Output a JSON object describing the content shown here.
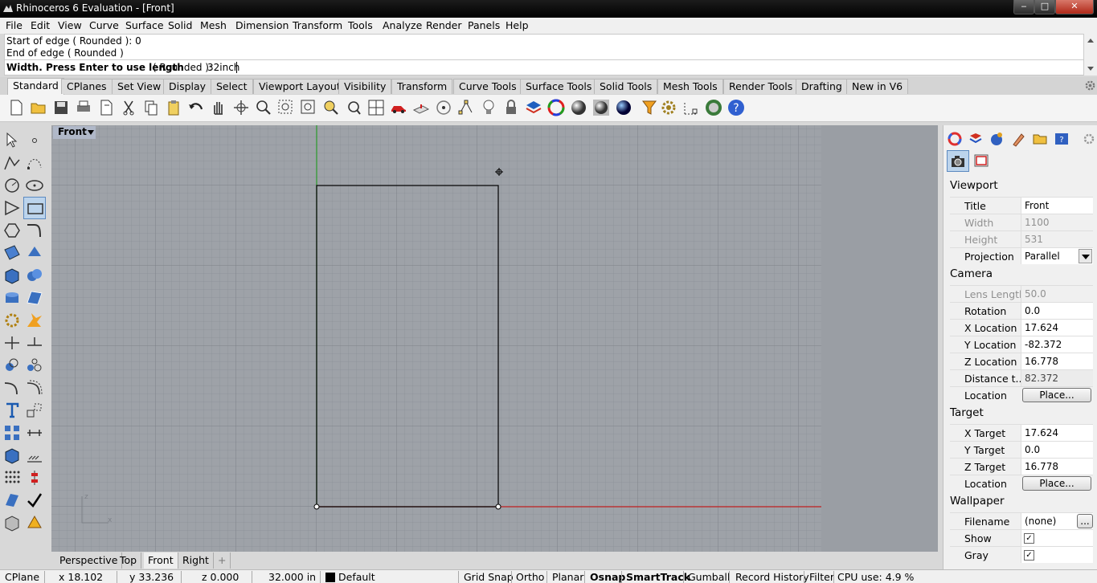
{
  "window": {
    "title": "Rhinoceros 6 Evaluation - [Front]",
    "min": "‒",
    "max": "□",
    "close": "✕"
  },
  "menu": [
    "File",
    "Edit",
    "View",
    "Curve",
    "Surface",
    "Solid",
    "Mesh",
    "Dimension",
    "Transform",
    "Tools",
    "Analyze",
    "Render",
    "Panels",
    "Help"
  ],
  "command": {
    "history": [
      "Start of edge ( Rounded ): 0",
      "End of edge ( Rounded )"
    ],
    "prompt": "Width. Press Enter to use length",
    "option": "( Rounded ):",
    "value": "32inch"
  },
  "toolbar_tabs": [
    "Standard",
    "CPlanes",
    "Set View",
    "Display",
    "Select",
    "Viewport Layout",
    "Visibility",
    "Transform",
    "Curve Tools",
    "Surface Tools",
    "Solid Tools",
    "Mesh Tools",
    "Render Tools",
    "Drafting",
    "New in V6"
  ],
  "viewport": {
    "name": "Front",
    "axis_z": "z",
    "axis_x": "x"
  },
  "viewport_tabs": [
    "Perspective",
    "Top",
    "Front",
    "Right"
  ],
  "viewport_add": "+",
  "status": {
    "cplane": "CPlane",
    "x": "x 18.102",
    "y": "y 33.236",
    "z": "z 0.000",
    "dist": "32.000 in",
    "layer": "Default",
    "toggles": [
      "Grid Snap",
      "Ortho",
      "Planar",
      "Osnap",
      "SmartTrack",
      "Gumball",
      "Record History",
      "Filter"
    ],
    "cpu": "CPU use: 4.9 %"
  },
  "panel": {
    "viewport_header": "Viewport",
    "title_label": "Title",
    "title_value": "Front",
    "width_label": "Width",
    "width_value": "1100",
    "height_label": "Height",
    "height_value": "531",
    "projection_label": "Projection",
    "projection_value": "Parallel",
    "camera_header": "Camera",
    "lens_label": "Lens Length",
    "lens_value": "50.0",
    "rotation_label": "Rotation",
    "rotation_value": "0.0",
    "xloc_label": "X Location",
    "xloc_value": "17.624",
    "yloc_label": "Y Location",
    "yloc_value": "-82.372",
    "zloc_label": "Z Location",
    "zloc_value": "16.778",
    "dist_label": "Distance t...",
    "dist_value": "82.372",
    "location_label": "Location",
    "place_label": "Place...",
    "target_header": "Target",
    "xt_label": "X Target",
    "xt_value": "17.624",
    "yt_label": "Y Target",
    "yt_value": "0.0",
    "zt_label": "Z Target",
    "zt_value": "16.778",
    "tlocation_label": "Location",
    "tplace_label": "Place...",
    "wallpaper_header": "Wallpaper",
    "filename_label": "Filename",
    "filename_value": "(none)",
    "browse_label": "...",
    "show_label": "Show",
    "gray_label": "Gray",
    "check": "✓"
  }
}
